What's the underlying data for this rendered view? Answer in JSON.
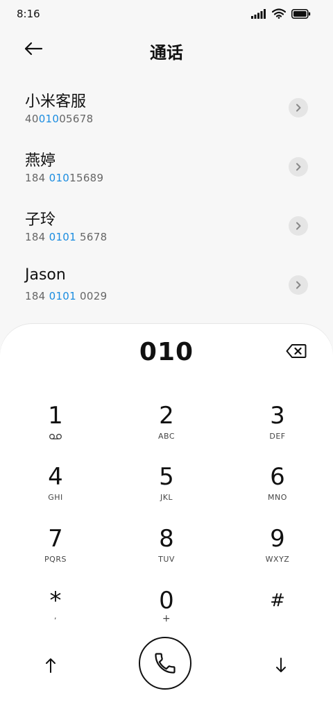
{
  "status_bar": {
    "time": "8:16"
  },
  "header": {
    "title": "通话"
  },
  "contacts": [
    {
      "name": "小米客服",
      "number_prefix": "40",
      "number_match": "010",
      "number_suffix": "05678"
    },
    {
      "name": "燕婷",
      "number_prefix": "184 ",
      "number_match": "010",
      "number_suffix": "15689"
    },
    {
      "name": "子玲",
      "number_prefix": "184 ",
      "number_match": "0101",
      "number_suffix": " 5678"
    },
    {
      "name": "Jason",
      "number_prefix": "184 ",
      "number_match": "0101",
      "number_suffix": " 0029"
    }
  ],
  "dialpad": {
    "entered_number": "010",
    "keys": [
      {
        "digit": "1",
        "letters": ""
      },
      {
        "digit": "2",
        "letters": "ABC"
      },
      {
        "digit": "3",
        "letters": "DEF"
      },
      {
        "digit": "4",
        "letters": "GHI"
      },
      {
        "digit": "5",
        "letters": "JKL"
      },
      {
        "digit": "6",
        "letters": "MNO"
      },
      {
        "digit": "7",
        "letters": "PQRS"
      },
      {
        "digit": "8",
        "letters": "TUV"
      },
      {
        "digit": "9",
        "letters": "WXYZ"
      },
      {
        "digit": "*",
        "letters": ","
      },
      {
        "digit": "0",
        "letters": "+"
      },
      {
        "digit": "#",
        "letters": ""
      }
    ]
  },
  "colors": {
    "highlight": "#1a8ce0",
    "background": "#f7f7f7",
    "dialpad_bg": "#ffffff"
  },
  "icons": [
    "signal-icon",
    "wifi-icon",
    "battery-icon",
    "back-arrow-icon",
    "chevron-right-icon",
    "backspace-icon",
    "voicemail-icon",
    "arrow-up-icon",
    "phone-icon",
    "arrow-down-icon"
  ]
}
